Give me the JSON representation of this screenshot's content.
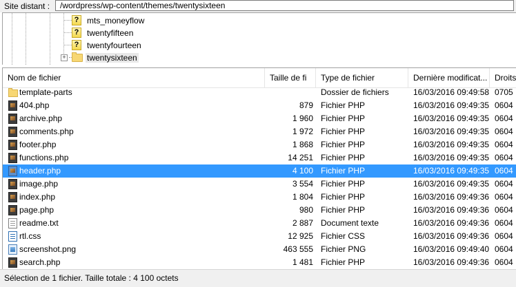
{
  "remote_site": {
    "label": "Site distant :",
    "path": "/wordpress/wp-content/themes/twentysixteen"
  },
  "tree": {
    "items": [
      {
        "label": "mts_moneyflow",
        "icon": "question-folder-icon"
      },
      {
        "label": "twentyfifteen",
        "icon": "question-folder-icon"
      },
      {
        "label": "twentyfourteen",
        "icon": "question-folder-icon"
      },
      {
        "label": "twentysixteen",
        "icon": "folder-icon",
        "expander": "+"
      }
    ]
  },
  "file_list": {
    "columns": [
      "Nom de fichier",
      "Taille de fi",
      "Type de fichier",
      "Dernière modificat...",
      "Droits"
    ],
    "rows": [
      {
        "name": "template-parts",
        "size": "",
        "type": "Dossier de fichiers",
        "modified": "16/03/2016 09:49:58",
        "perms": "0705",
        "icon": "folder-icon"
      },
      {
        "name": "404.php",
        "size": "879",
        "type": "Fichier PHP",
        "modified": "16/03/2016 09:49:35",
        "perms": "0604",
        "icon": "php-file-icon"
      },
      {
        "name": "archive.php",
        "size": "1 960",
        "type": "Fichier PHP",
        "modified": "16/03/2016 09:49:35",
        "perms": "0604",
        "icon": "php-file-icon"
      },
      {
        "name": "comments.php",
        "size": "1 972",
        "type": "Fichier PHP",
        "modified": "16/03/2016 09:49:35",
        "perms": "0604",
        "icon": "php-file-icon"
      },
      {
        "name": "footer.php",
        "size": "1 868",
        "type": "Fichier PHP",
        "modified": "16/03/2016 09:49:35",
        "perms": "0604",
        "icon": "php-file-icon"
      },
      {
        "name": "functions.php",
        "size": "14 251",
        "type": "Fichier PHP",
        "modified": "16/03/2016 09:49:35",
        "perms": "0604",
        "icon": "php-file-icon"
      },
      {
        "name": "header.php",
        "size": "4 100",
        "type": "Fichier PHP",
        "modified": "16/03/2016 09:49:35",
        "perms": "0604",
        "icon": "php-file-icon",
        "selected": true
      },
      {
        "name": "image.php",
        "size": "3 554",
        "type": "Fichier PHP",
        "modified": "16/03/2016 09:49:35",
        "perms": "0604",
        "icon": "php-file-icon"
      },
      {
        "name": "index.php",
        "size": "1 804",
        "type": "Fichier PHP",
        "modified": "16/03/2016 09:49:36",
        "perms": "0604",
        "icon": "php-file-icon"
      },
      {
        "name": "page.php",
        "size": "980",
        "type": "Fichier PHP",
        "modified": "16/03/2016 09:49:36",
        "perms": "0604",
        "icon": "php-file-icon"
      },
      {
        "name": "readme.txt",
        "size": "2 887",
        "type": "Document texte",
        "modified": "16/03/2016 09:49:36",
        "perms": "0604",
        "icon": "text-file-icon"
      },
      {
        "name": "rtl.css",
        "size": "12 925",
        "type": "Fichier CSS",
        "modified": "16/03/2016 09:49:36",
        "perms": "0604",
        "icon": "css-file-icon"
      },
      {
        "name": "screenshot.png",
        "size": "463 555",
        "type": "Fichier PNG",
        "modified": "16/03/2016 09:49:40",
        "perms": "0604",
        "icon": "image-file-icon"
      },
      {
        "name": "search.php",
        "size": "1 481",
        "type": "Fichier PHP",
        "modified": "16/03/2016 09:49:36",
        "perms": "0604",
        "icon": "php-file-icon"
      }
    ]
  },
  "status": {
    "text": "Sélection de 1 fichier. Taille totale : 4 100 octets"
  },
  "colors": {
    "selection": "#3399ff",
    "folder": "#f7d774",
    "chrome": "#f0f0f0"
  }
}
